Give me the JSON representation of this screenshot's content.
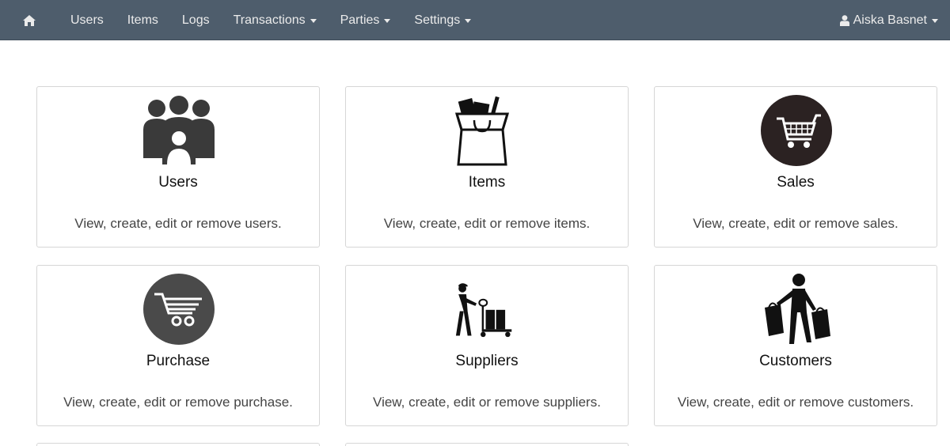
{
  "navbar": {
    "home_icon": "home-icon",
    "items": [
      {
        "label": "Users",
        "dropdown": false
      },
      {
        "label": "Items",
        "dropdown": false
      },
      {
        "label": "Logs",
        "dropdown": false
      },
      {
        "label": "Transactions",
        "dropdown": true
      },
      {
        "label": "Parties",
        "dropdown": true
      },
      {
        "label": "Settings",
        "dropdown": true
      }
    ],
    "user": {
      "name": "Aiska Basnet",
      "icon": "user-icon"
    },
    "bg_color": "#4e5d6c"
  },
  "cards": [
    {
      "title": "Users",
      "desc": "View, create, edit or remove users.",
      "icon": "users-group-icon"
    },
    {
      "title": "Items",
      "desc": "View, create, edit or remove items.",
      "icon": "shopping-bag-icon"
    },
    {
      "title": "Sales",
      "desc": "View, create, edit or remove sales.",
      "icon": "shopping-cart-icon"
    },
    {
      "title": "Purchase",
      "desc": "View, create, edit or remove purchase.",
      "icon": "shopping-cart-icon"
    },
    {
      "title": "Suppliers",
      "desc": "View, create, edit or remove suppliers.",
      "icon": "delivery-worker-icon"
    },
    {
      "title": "Customers",
      "desc": "View, create, edit or remove customers.",
      "icon": "shopper-icon"
    }
  ]
}
